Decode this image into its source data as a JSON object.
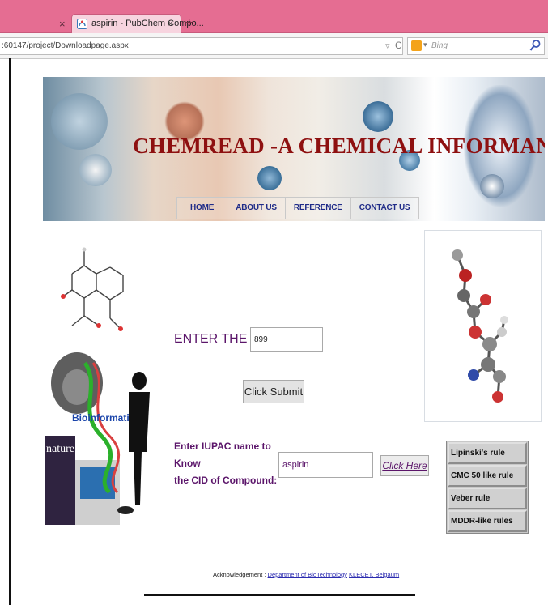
{
  "browser": {
    "tab": {
      "title": "aspirin - PubChem Compo...",
      "close": "×"
    },
    "inactive_tab_close": "×",
    "new_tab": "+",
    "url": ":60147/project/Downloadpage.aspx",
    "url_star": "▿",
    "url_reload": "C",
    "search_engine_caret": "▾",
    "search_placeholder": "Bing"
  },
  "banner": {
    "title": "CHEMREAD -A CHEMICAL INFORMANT",
    "nav": [
      "HOME",
      "ABOUT US",
      "REFERENCE",
      "CONTACT US"
    ]
  },
  "form": {
    "cid_label": "ENTER THE CID:",
    "cid_value": "899",
    "submit_label": "Click Submit",
    "iupac_label_line1": "Enter IUPAC name to Know",
    "iupac_label_line2": "the CID of Compound:",
    "iupac_value": "aspirin",
    "click_here_label": "Click Here"
  },
  "rules": [
    "Lipinski's rule",
    "CMC 50 like rule",
    "Veber rule",
    "MDDR-like rules"
  ],
  "footer": {
    "ack_prefix": "Acknowledgement :",
    "dept_link": "Department of BioTechnology",
    "college_link": "KLECET, Belgaum"
  },
  "colors": {
    "tab_bar": "#e56d92",
    "title_red": "#8e1010",
    "nav_blue": "#1f2b88",
    "label_purple": "#5b156a"
  },
  "icons": {
    "favicon": "pubchem-favicon-icon",
    "search": "magnifier-icon",
    "search_engine": "bing-icon"
  }
}
